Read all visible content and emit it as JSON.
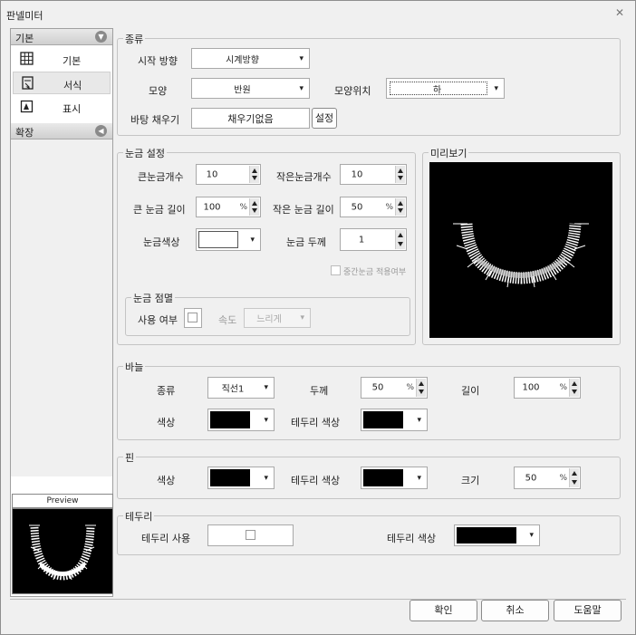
{
  "window": {
    "title": "판넬미터",
    "close_icon": "✕"
  },
  "nav": {
    "basic_category": "기본",
    "extension_category": "확장",
    "items": [
      {
        "label": "기본",
        "icon": "grid-icon"
      },
      {
        "label": "서식",
        "icon": "format-icon"
      },
      {
        "label": "표시",
        "icon": "display-icon"
      }
    ],
    "preview_label": "Preview"
  },
  "type_group": {
    "title": "종류",
    "start_direction_label": "시작 방향",
    "start_direction_value": "시계방향",
    "shape_label": "모양",
    "shape_value": "반원",
    "shape_position_label": "모양위치",
    "shape_position_value": "하",
    "fill_label": "바탕 채우기",
    "fill_value": "채우기없음",
    "fill_settings_button": "설정"
  },
  "tick_group": {
    "title": "눈금 설정",
    "major_count_label": "큰눈금개수",
    "major_count_value": "10",
    "minor_count_label": "작은눈금개수",
    "minor_count_value": "10",
    "major_length_label": "큰 눈금 길이",
    "major_length_value": "100",
    "minor_length_label": "작은 눈금 길이",
    "minor_length_value": "50",
    "percent": "%",
    "color_label": "눈금색상",
    "color_value": "#ffffff",
    "thickness_label": "눈금 두께",
    "thickness_value": "1",
    "apply_middle_label": "중간눈금 적용여부",
    "blink_title": "눈금 점멸",
    "use_label": "사용 여부",
    "speed_label": "속도",
    "speed_value": "느리게"
  },
  "preview_group": {
    "title": "미리보기"
  },
  "needle_group": {
    "title": "바늘",
    "type_label": "종류",
    "type_value": "직선1",
    "thickness_label": "두께",
    "thickness_value": "50",
    "length_label": "길이",
    "length_value": "100",
    "percent": "%",
    "color_label": "색상",
    "color_value": "#000000",
    "border_color_label": "테두리 색상",
    "border_color_value": "#000000"
  },
  "pin_group": {
    "title": "핀",
    "color_label": "색상",
    "color_value": "#000000",
    "border_color_label": "테두리 색상",
    "border_color_value": "#000000",
    "size_label": "크기",
    "size_value": "50",
    "percent": "%"
  },
  "border_group": {
    "title": "테두리",
    "use_label": "테두리 사용",
    "color_label": "테두리 색상",
    "color_value": "#000000"
  },
  "buttons": {
    "ok": "확인",
    "cancel": "취소",
    "help": "도움말"
  }
}
